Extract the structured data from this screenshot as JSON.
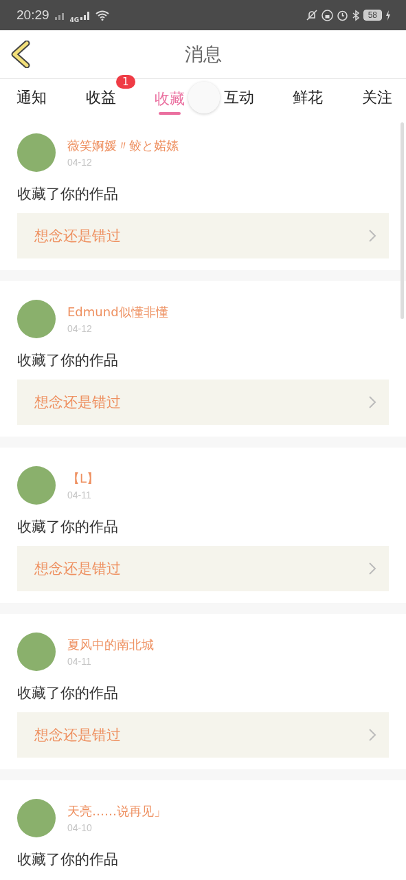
{
  "status_bar": {
    "time": "20:29",
    "network": "4G",
    "battery": "58"
  },
  "header": {
    "title": "消息"
  },
  "tabs": [
    {
      "label": "通知",
      "selected": false
    },
    {
      "label": "收益",
      "selected": false,
      "badge": "1"
    },
    {
      "label": "收藏",
      "selected": true
    },
    {
      "label": "互动",
      "selected": false
    },
    {
      "label": "鲜花",
      "selected": false
    },
    {
      "label": "关注",
      "selected": false
    }
  ],
  "messages": [
    {
      "user": "薇笑婀媛〃鲛と婼嫊",
      "date": "04-12",
      "action": "收藏了你的作品",
      "work": "想念还是错过"
    },
    {
      "user": "Edmund似懂非懂",
      "date": "04-12",
      "action": "收藏了你的作品",
      "work": "想念还是错过"
    },
    {
      "user": "【L】",
      "date": "04-11",
      "action": "收藏了你的作品",
      "work": "想念还是错过"
    },
    {
      "user": "夏风中的南北城",
      "date": "04-11",
      "action": "收藏了你的作品",
      "work": "想念还是错过"
    },
    {
      "user": "天亮……说再见」",
      "date": "04-10",
      "action": "收藏了你的作品"
    }
  ]
}
